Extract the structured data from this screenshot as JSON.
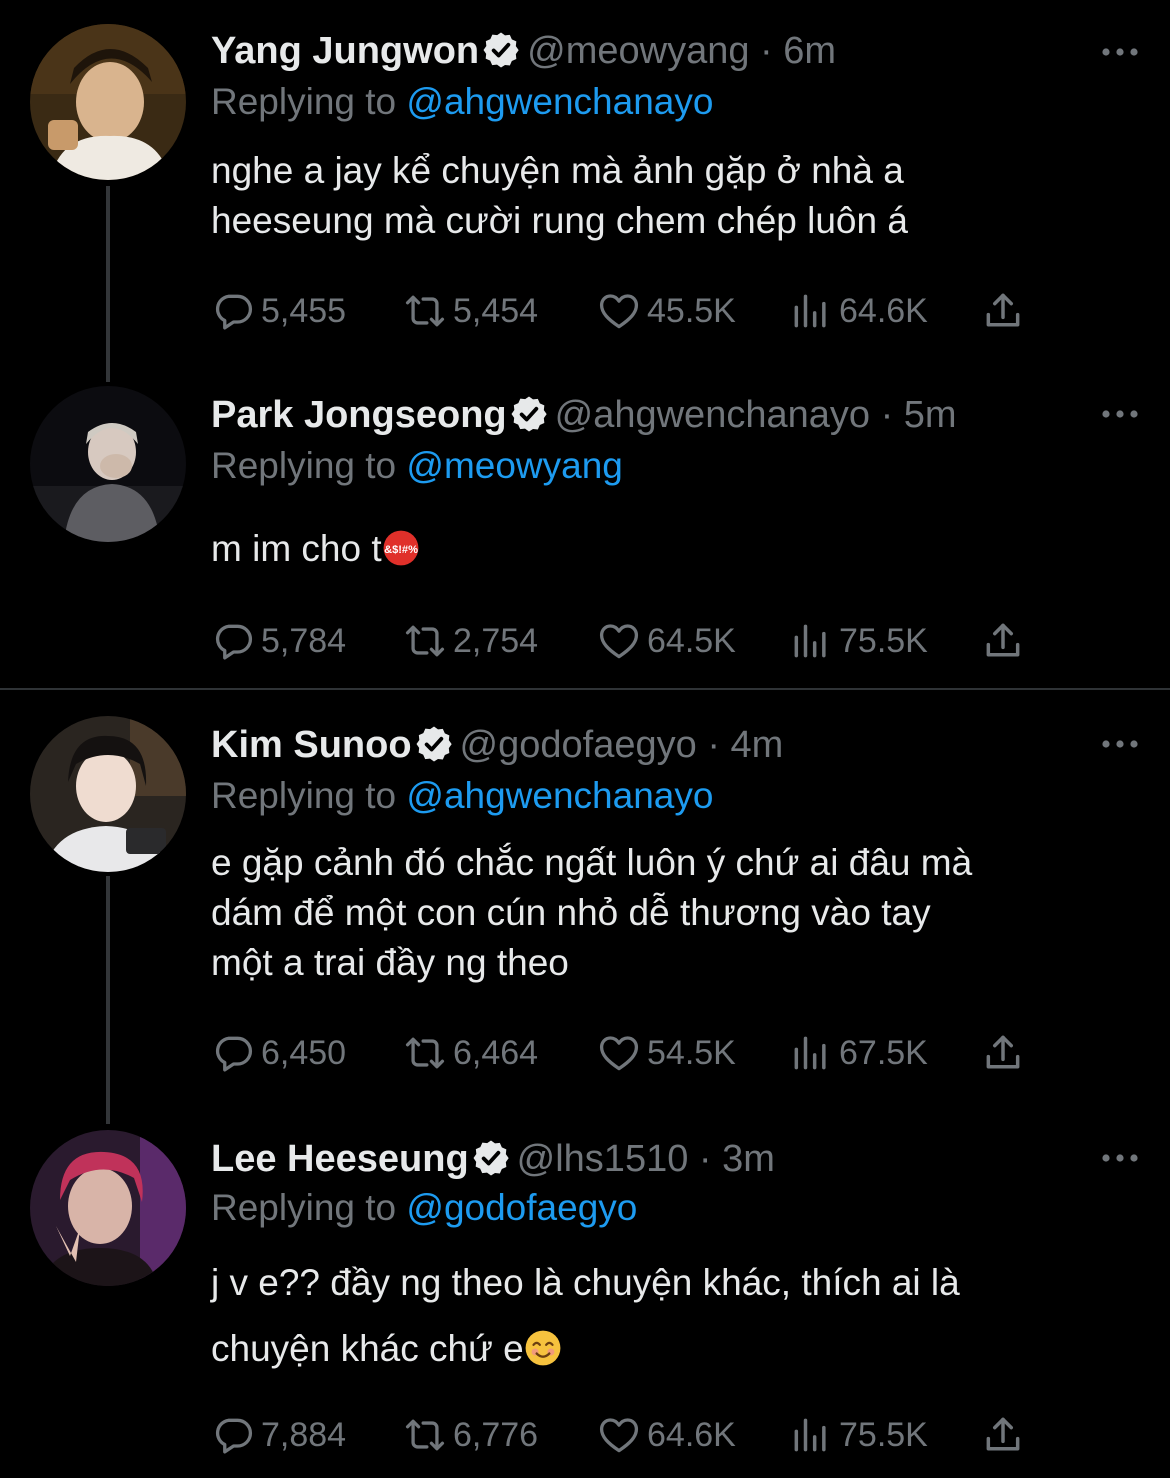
{
  "tweets": [
    {
      "name": "Yang Jungwon",
      "handle": "@meowyang",
      "time": "· 6m",
      "replying_prefix": "Replying to",
      "replying_to": "@ahgwenchanayo",
      "lines": [
        "nghe a jay kể chuyện mà ảnh gặp ở nhà a",
        "heeseung mà cười rung chem chép luôn á"
      ],
      "emoji": "",
      "stats": {
        "replies": "5,455",
        "retweets": "5,454",
        "likes": "45.5K",
        "views": "64.6K"
      }
    },
    {
      "name": "Park Jongseong",
      "handle": "@ahgwenchanayo",
      "time": "· 5m",
      "replying_prefix": "Replying to",
      "replying_to": "@meowyang",
      "lines": [
        "m im cho t"
      ],
      "emoji": "angry-symbols-emoji",
      "stats": {
        "replies": "5,784",
        "retweets": "2,754",
        "likes": "64.5K",
        "views": "75.5K"
      }
    },
    {
      "name": "Kim Sunoo",
      "handle": "@godofaegyo",
      "time": "· 4m",
      "replying_prefix": "Replying to",
      "replying_to": "@ahgwenchanayo",
      "lines": [
        "e gặp cảnh đó chắc ngất luôn ý chứ ai đâu mà",
        "dám để một con cún nhỏ dễ thương vào tay",
        "một a trai đầy ng theo"
      ],
      "emoji": "",
      "stats": {
        "replies": "6,450",
        "retweets": "6,464",
        "likes": "54.5K",
        "views": "67.5K"
      }
    },
    {
      "name": "Lee Heeseung",
      "handle": "@lhs1510",
      "time": "· 3m",
      "replying_prefix": "Replying to",
      "replying_to": "@godofaegyo",
      "lines": [
        "j v e?? đầy ng theo là chuyện khác, thích ai là",
        "chuyện khác chứ e"
      ],
      "emoji": "smiling-face-emoji",
      "stats": {
        "replies": "7,884",
        "retweets": "6,776",
        "likes": "64.6K",
        "views": "75.5K"
      }
    }
  ],
  "colors": {
    "background": "#000000",
    "text": "#e7e9ea",
    "muted": "#71767b",
    "link": "#1d9bf0",
    "divider": "#2f3336"
  },
  "icons": [
    "verified-badge-icon",
    "more-dots-icon",
    "reply-icon",
    "retweet-icon",
    "like-icon",
    "views-icon",
    "share-icon"
  ]
}
